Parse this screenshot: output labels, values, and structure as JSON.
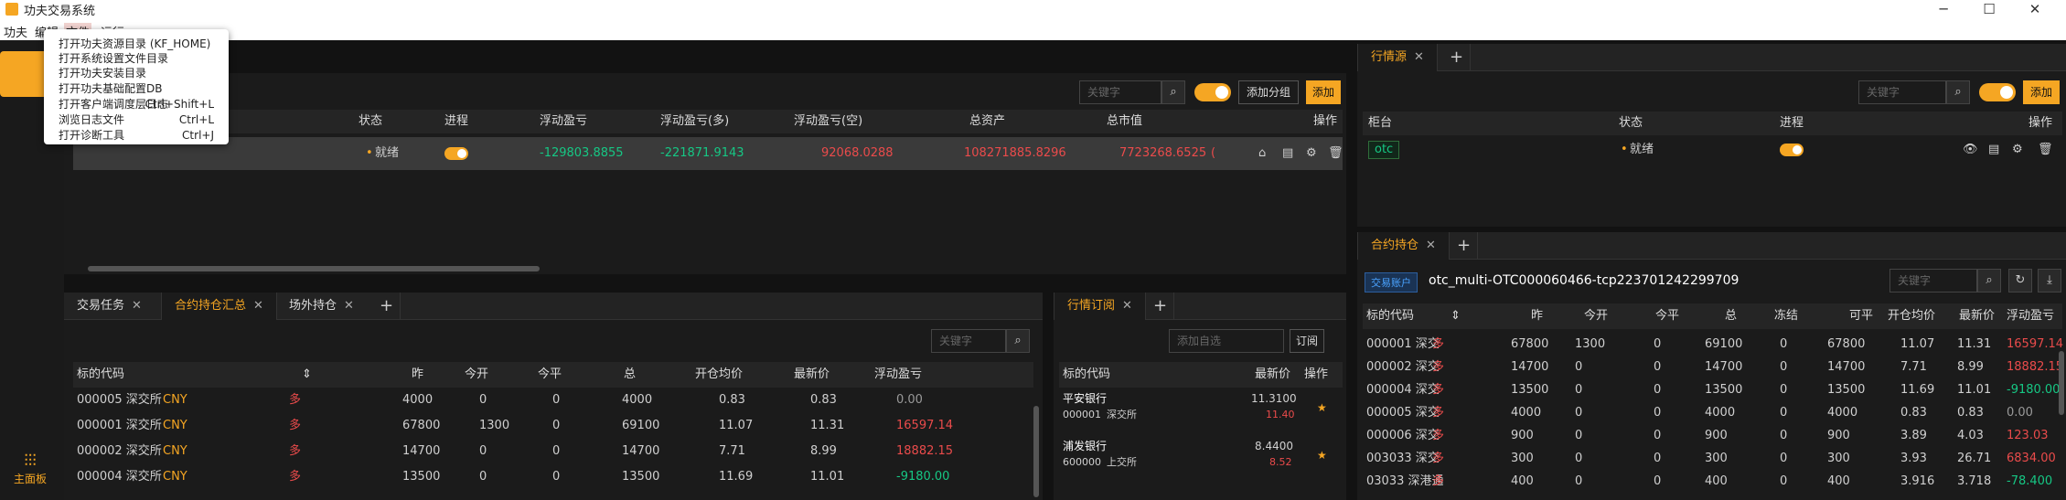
{
  "window": {
    "title": "功夫交易系统"
  },
  "menu": [
    "功夫",
    "编辑",
    "文件",
    "运行"
  ],
  "file_menu": [
    {
      "label": "打开功夫资源目录 (KF_HOME)",
      "shortcut": ""
    },
    {
      "label": "打开系统设置文件目录",
      "shortcut": ""
    },
    {
      "label": "打开功夫安装目录",
      "shortcut": ""
    },
    {
      "label": "打开功夫基础配置DB",
      "shortcut": ""
    },
    {
      "label": "打开客户端调度层日志",
      "shortcut": "Ctrl+Shift+L"
    },
    {
      "label": "浏览日志文件",
      "shortcut": "Ctrl+L"
    },
    {
      "label": "打开诊断工具",
      "shortcut": "Ctrl+J"
    }
  ],
  "sidebar": {
    "bottom_label": "主面板"
  },
  "accounts": {
    "search_placeholder": "关键字",
    "add_group": "添加分组",
    "add": "添加",
    "columns": [
      "状态",
      "进程",
      "浮动盈亏",
      "浮动盈亏(多)",
      "浮动盈亏(空)",
      "总资产",
      "总市值",
      "操作"
    ],
    "row": {
      "status": "就绪",
      "pnl": "-129803.8855",
      "pnl_long": "-221871.9143",
      "pnl_short": "92068.0288",
      "total_assets": "108271885.8296",
      "market_value": "7723268.6525",
      "extra": "("
    }
  },
  "market_source": {
    "tab": "行情源",
    "search_placeholder": "关键字",
    "add": "添加",
    "columns": [
      "柜台",
      "状态",
      "进程",
      "操作"
    ],
    "row": {
      "counter": "otc",
      "status": "就绪"
    }
  },
  "positions_summary": {
    "tabs": [
      "交易任务",
      "合约持仓汇总",
      "场外持仓"
    ],
    "search_placeholder": "关键字",
    "columns": [
      "标的代码",
      "昨",
      "今开",
      "今平",
      "总",
      "开仓均价",
      "最新价",
      "浮动盈亏"
    ],
    "rows": [
      {
        "code": "000005 深交所",
        "cur": "CNY",
        "dir": "多",
        "y": "4000",
        "o": "0",
        "c": "0",
        "t": "4000",
        "avg": "0.83",
        "last": "0.83",
        "pnl": "0.00",
        "pc": "gray"
      },
      {
        "code": "000001 深交所",
        "cur": "CNY",
        "dir": "多",
        "y": "67800",
        "o": "1300",
        "c": "0",
        "t": "69100",
        "avg": "11.07",
        "last": "11.31",
        "pnl": "16597.14",
        "pc": "red"
      },
      {
        "code": "000002 深交所",
        "cur": "CNY",
        "dir": "多",
        "y": "14700",
        "o": "0",
        "c": "0",
        "t": "14700",
        "avg": "7.71",
        "last": "8.99",
        "pnl": "18882.15",
        "pc": "red"
      },
      {
        "code": "000004 深交所",
        "cur": "CNY",
        "dir": "多",
        "y": "13500",
        "o": "0",
        "c": "0",
        "t": "13500",
        "avg": "11.69",
        "last": "11.01",
        "pnl": "-9180.00",
        "pc": "green"
      }
    ]
  },
  "subscriptions": {
    "tab": "行情订阅",
    "placeholder": "添加自选",
    "subscribe": "订阅",
    "columns": [
      "标的代码",
      "最新价",
      "操作"
    ],
    "rows": [
      {
        "name": "平安银行",
        "code": "000001",
        "ex": "深交所",
        "price": "11.3100",
        "sub": "11.40"
      },
      {
        "name": "浦发银行",
        "code": "600000",
        "ex": "上交所",
        "price": "8.4400",
        "sub": "8.52"
      }
    ]
  },
  "contract_positions": {
    "tab": "合约持仓",
    "account_badge": "交易账户",
    "account": "otc_multi-OTC000060466-tcp223701242299709",
    "search_placeholder": "关键字",
    "columns": [
      "标的代码",
      "昨",
      "今开",
      "今平",
      "总",
      "冻结",
      "可平",
      "开仓均价",
      "最新价",
      "浮动盈亏"
    ],
    "rows": [
      {
        "code": "000001 深交",
        "dir": "多",
        "y": "67800",
        "o": "1300",
        "c": "0",
        "t": "69100",
        "f": "0",
        "cp": "67800",
        "avg": "11.07",
        "last": "11.31",
        "pnl": "16597.14",
        "pc": "red"
      },
      {
        "code": "000002 深交",
        "dir": "多",
        "y": "14700",
        "o": "0",
        "c": "0",
        "t": "14700",
        "f": "0",
        "cp": "14700",
        "avg": "7.71",
        "last": "8.99",
        "pnl": "18882.15",
        "pc": "red"
      },
      {
        "code": "000004 深交",
        "dir": "多",
        "y": "13500",
        "o": "0",
        "c": "0",
        "t": "13500",
        "f": "0",
        "cp": "13500",
        "avg": "11.69",
        "last": "11.01",
        "pnl": "-9180.00",
        "pc": "green"
      },
      {
        "code": "000005 深交",
        "dir": "多",
        "y": "4000",
        "o": "0",
        "c": "0",
        "t": "4000",
        "f": "0",
        "cp": "4000",
        "avg": "0.83",
        "last": "0.83",
        "pnl": "0.00",
        "pc": "gray"
      },
      {
        "code": "000006 深交",
        "dir": "多",
        "y": "900",
        "o": "0",
        "c": "0",
        "t": "900",
        "f": "0",
        "cp": "900",
        "avg": "3.89",
        "last": "4.03",
        "pnl": "123.03",
        "pc": "red"
      },
      {
        "code": "003033 深交",
        "dir": "多",
        "y": "300",
        "o": "0",
        "c": "0",
        "t": "300",
        "f": "0",
        "cp": "300",
        "avg": "3.93",
        "last": "26.71",
        "pnl": "6834.00",
        "pc": "red"
      },
      {
        "code": "03033 深港通",
        "dir": "多",
        "y": "400",
        "o": "0",
        "c": "0",
        "t": "400",
        "f": "0",
        "cp": "400",
        "avg": "3.916",
        "last": "3.718",
        "pnl": "-78.400",
        "pc": "green"
      }
    ]
  },
  "colors": {
    "accent": "#f5a623",
    "up": "#ea4b4b",
    "down": "#16c784"
  }
}
